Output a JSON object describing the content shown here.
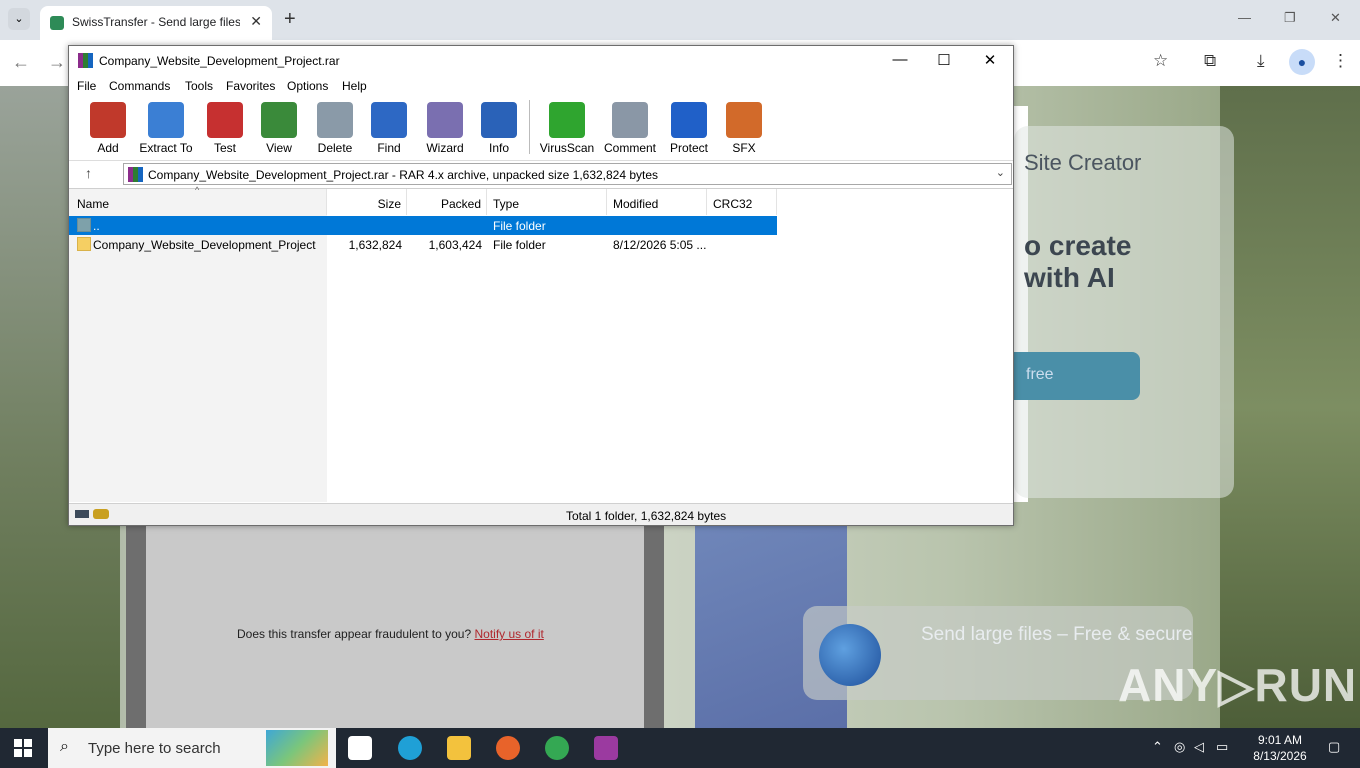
{
  "browser": {
    "tab_title": "SwissTransfer - Send large files",
    "tab_close": "✕",
    "new_tab": "+",
    "window_controls": [
      "—",
      "❐",
      "✕"
    ],
    "nav": {
      "back": "←",
      "forward": "→"
    },
    "toolbar_icons": [
      "☆",
      "⧉",
      "⤓",
      "⋮"
    ]
  },
  "webpage": {
    "card_title": "Site Creator",
    "card_headline": "o create\nwith AI",
    "card_button": "free",
    "send_box_text": "Send large files – Free & secure",
    "fraud_text": "Does this transfer appear fraudulent to you? ",
    "fraud_link": "Notify us of it",
    "watermark": "ANY▷RUN"
  },
  "winrar": {
    "title": "Company_Website_Development_Project.rar",
    "controls": {
      "minimize": "—",
      "maximize": "☐",
      "close": "✕"
    },
    "menu": [
      "File",
      "Commands",
      "Tools",
      "Favorites",
      "Options",
      "Help"
    ],
    "toolbar": [
      {
        "label": "Add",
        "color": "#c0392b"
      },
      {
        "label": "Extract To",
        "color": "#3b7fd4"
      },
      {
        "label": "Test",
        "color": "#c63030"
      },
      {
        "label": "View",
        "color": "#3a8a3a"
      },
      {
        "label": "Delete",
        "color": "#8a9aa8"
      },
      {
        "label": "Find",
        "color": "#2d68c4"
      },
      {
        "label": "Wizard",
        "color": "#7a6fb0"
      },
      {
        "label": "Info",
        "color": "#2a62b8"
      },
      {
        "label": "VirusScan",
        "color": "#2fa52f"
      },
      {
        "label": "Comment",
        "color": "#8a97a6"
      },
      {
        "label": "Protect",
        "color": "#2060c8"
      },
      {
        "label": "SFX",
        "color": "#d26a2a"
      }
    ],
    "path": "Company_Website_Development_Project.rar - RAR 4.x archive, unpacked size 1,632,824 bytes",
    "columns": [
      "Name",
      "Size",
      "Packed",
      "Type",
      "Modified",
      "CRC32"
    ],
    "rows": [
      {
        "name": "..",
        "size": "",
        "packed": "",
        "type": "File folder",
        "modified": "",
        "crc": ""
      },
      {
        "name": "Company_Website_Development_Project",
        "size": "1,632,824",
        "packed": "1,603,424",
        "type": "File folder",
        "modified": "8/12/2026 5:05 ...",
        "crc": ""
      }
    ],
    "status": "Total 1 folder, 1,632,824 bytes"
  },
  "taskbar": {
    "search_placeholder": "Type here to search",
    "time": "9:01 AM",
    "date": "8/13/2026",
    "apps": [
      {
        "name": "task-view",
        "color": "#ffffff"
      },
      {
        "name": "edge",
        "color": "#1fa0d6"
      },
      {
        "name": "file-explorer",
        "color": "#f3c23d"
      },
      {
        "name": "firefox",
        "color": "#e8632a"
      },
      {
        "name": "chrome",
        "color": "#34a853"
      },
      {
        "name": "winrar",
        "color": "#9b3aa0"
      }
    ]
  }
}
